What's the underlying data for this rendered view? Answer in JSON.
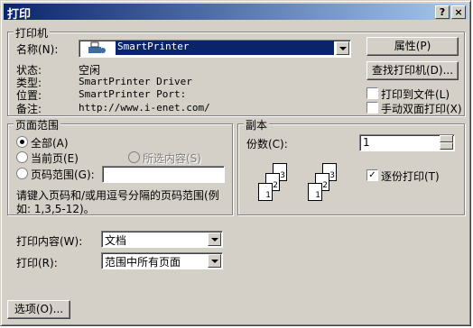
{
  "window": {
    "title": "打印",
    "help_btn": "?",
    "close_btn": "×"
  },
  "printer": {
    "group": "打印机",
    "name_label": "名称(N):",
    "name_value": "SmartPrinter",
    "status_label": "状态:",
    "status_value": "空闲",
    "type_label": "类型:",
    "type_value": "SmartPrinter Driver",
    "where_label": "位置:",
    "where_value": "SmartPrinter Port:",
    "comment_label": "备注:",
    "comment_value": "http://www.i-enet.com/",
    "properties_btn": "属性(P)",
    "find_btn": "查找打印机(D)...",
    "print_to_file": "打印到文件(L)",
    "manual_duplex": "手动双面打印(X)"
  },
  "range": {
    "group": "页面范围",
    "all": "全部(A)",
    "current": "当前页(E)",
    "selection": "所选内容(S)",
    "pages": "页码范围(G):",
    "hint_line1": "请键入页码和/或用逗号分隔的页码范围(例",
    "hint_line2": "如: 1,3,5-12)。"
  },
  "copies": {
    "group": "副本",
    "count_label": "份数(C):",
    "count_value": "1",
    "collate": "逐份打印(T)",
    "stack1": [
      "3",
      "2",
      "1"
    ],
    "stack2": [
      "3",
      "2",
      "1"
    ]
  },
  "print_what": {
    "label": "打印内容(W):",
    "value": "文档"
  },
  "print_range": {
    "label": "打印(R):",
    "value": "范围中所有页面"
  },
  "options_btn": "选项(O)..."
}
